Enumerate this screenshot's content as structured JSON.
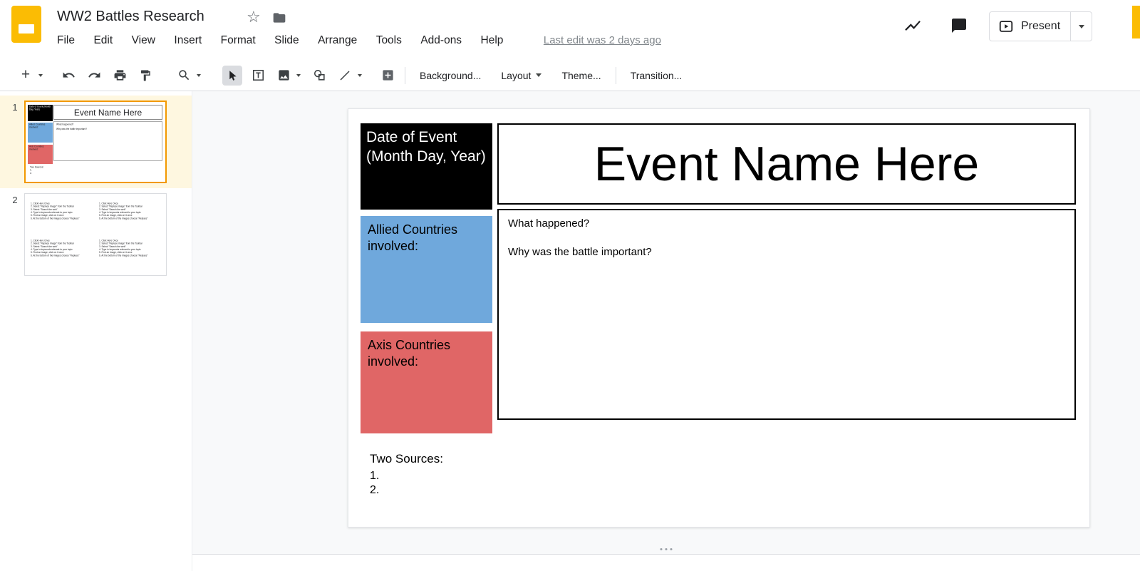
{
  "app": {
    "doc_title": "WW2 Battles Research",
    "last_edit": "Last edit was 2 days ago",
    "present_label": "Present",
    "menus": [
      "File",
      "Edit",
      "View",
      "Insert",
      "Format",
      "Slide",
      "Arrange",
      "Tools",
      "Add-ons",
      "Help"
    ]
  },
  "toolbar": {
    "background": "Background...",
    "layout": "Layout",
    "theme": "Theme...",
    "transition": "Transition..."
  },
  "filmstrip": {
    "slide1_number": "1",
    "slide2_number": "2"
  },
  "slide": {
    "date_box": "Date of Event (Month Day, Year)",
    "title": "Event Name Here",
    "body_q1": "What happened?",
    "body_q2": "Why was the battle important?",
    "allied_box": "Allied Countries involved:",
    "axis_box": "Axis Countries involved:",
    "sources_label": "Two Sources:",
    "source_1": "1.",
    "source_2": "2."
  },
  "thumb2": {
    "instructions": "1. Click Here Once\n2. Select \"Replace image\" from the Toolbar\n3. Select \"Search the web\"\n4. Type in keywords relevant to your topic\n5. Find an image, click on it once\n6. At the bottom of the images choose \"Replace\""
  },
  "colors": {
    "allied_blue": "#6fa8dc",
    "axis_red": "#e06666",
    "selected_slide_outline": "#f29900",
    "logo_yellow": "#fbbc04",
    "toolbar_border": "#dadce0"
  }
}
